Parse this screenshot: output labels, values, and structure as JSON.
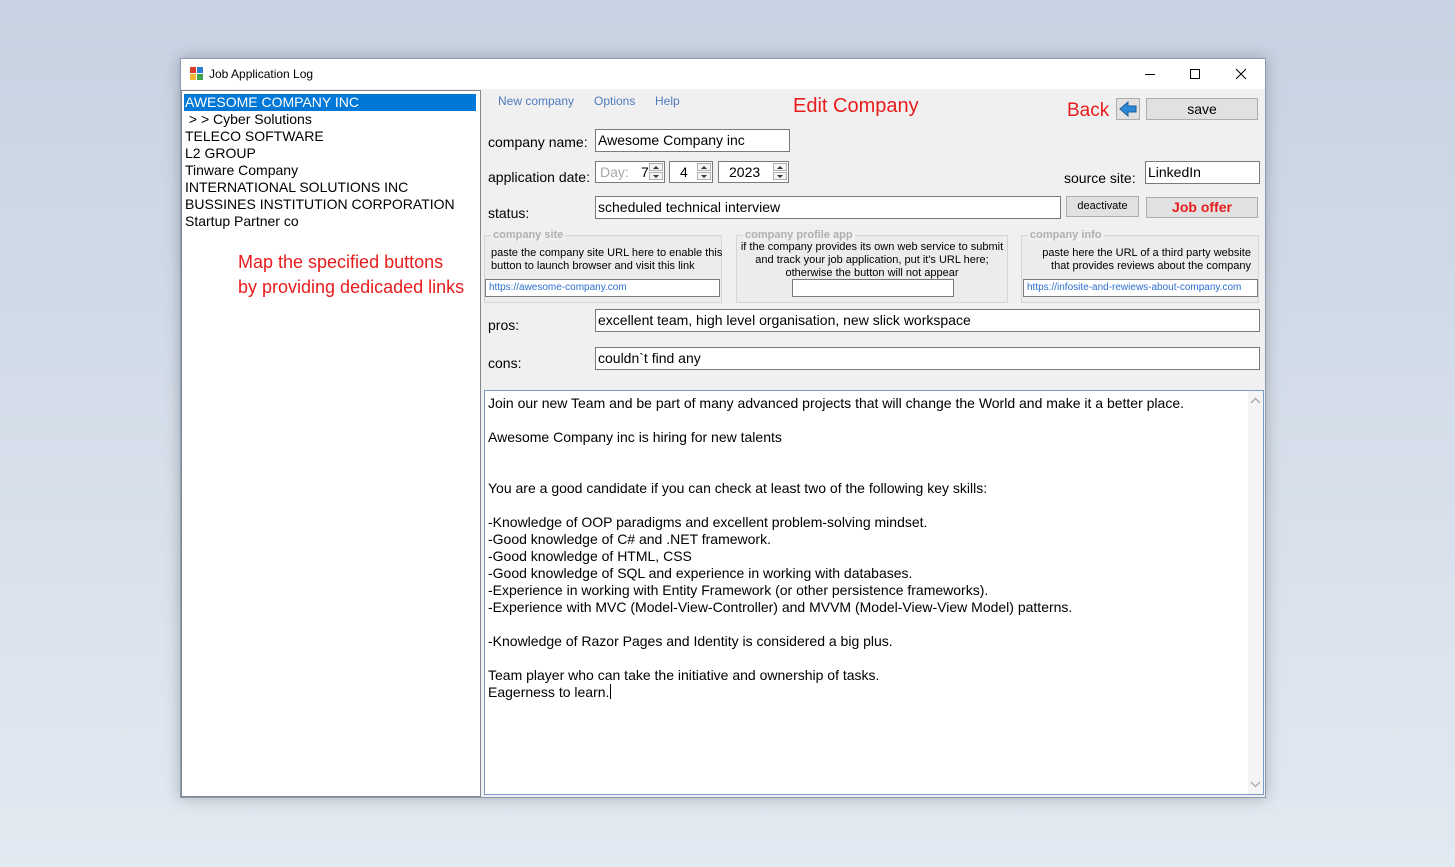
{
  "window": {
    "title": "Job Application Log"
  },
  "companies": [
    {
      "label": "AWESOME COMPANY INC",
      "selected": true
    },
    {
      "label": " > > Cyber Solutions",
      "selected": false
    },
    {
      "label": "TELECO SOFTWARE",
      "selected": false
    },
    {
      "label": "L2 GROUP",
      "selected": false
    },
    {
      "label": "Tinware Company",
      "selected": false
    },
    {
      "label": "INTERNATIONAL SOLUTIONS INC",
      "selected": false
    },
    {
      "label": "BUSSINES INSTITUTION CORPORATION",
      "selected": false
    },
    {
      "label": "Startup Partner co",
      "selected": false
    }
  ],
  "annotation": {
    "line1": "Map the specified buttons",
    "line2": "by providing dedicaded links"
  },
  "menu": {
    "new_company": "New company",
    "options": "Options",
    "help": "Help"
  },
  "header": {
    "title": "Edit Company",
    "back_label": "Back",
    "save_label": "save"
  },
  "form": {
    "company_name_label": "company name:",
    "company_name": "Awesome Company inc",
    "application_date_label": "application date:",
    "day_placeholder": "Day:",
    "day": "7",
    "month": "4",
    "year": "2023",
    "source_site_label": "source site:",
    "source_site": "LinkedIn",
    "status_label": "status:",
    "status": "scheduled technical interview",
    "deactivate_label": "deactivate",
    "job_offer_label": "Job offer",
    "pros_label": "pros:",
    "pros": "excellent team, high level organisation, new slick workspace",
    "cons_label": "cons:",
    "cons": "couldn`t find any"
  },
  "groups": {
    "company_site": {
      "title": "company site",
      "line1": "paste the company site URL here to enable this",
      "line2": "button to launch browser and visit this link",
      "url": "https://awesome-company.com"
    },
    "company_profile_app": {
      "title": "company profile app",
      "line1": "if the company provides its own web service to submit",
      "line2": "and track your job application, put it's URL here;",
      "line3": "otherwise the button will not appear",
      "url": ""
    },
    "company_info": {
      "title": "company info",
      "line1": "paste here the URL of a third party website",
      "line2": "that provides reviews about the company",
      "url": "https://infosite-and-rewiews-about-company.com"
    }
  },
  "description": {
    "lines": [
      "Join our new Team and be part of many advanced projects that will change the World and make it a better place.",
      "",
      "Awesome Company inc is hiring for new talents",
      "",
      "",
      "You are a good candidate if you can check at least two of the following key skills:",
      "",
      "-Knowledge of OOP paradigms and excellent problem-solving mindset.",
      "-Good knowledge of C# and .NET framework.",
      "-Good knowledge of HTML, CSS",
      "-Good knowledge of SQL and experience in working with databases.",
      "-Experience in working with Entity Framework (or other persistence frameworks).",
      "-Experience with MVC (Model-View-Controller) and MVVM (Model-View-View Model) patterns.",
      "",
      "-Knowledge of Razor Pages and Identity is considered a big plus.",
      "",
      "Team player who can take the initiative and ownership of tasks.",
      "Eagerness to learn."
    ]
  },
  "colors": {
    "accent": "#0078d7",
    "annotation_red": "#e81c1c",
    "menu_blue": "#4d7bbd",
    "url_blue": "#2a6fd0"
  }
}
